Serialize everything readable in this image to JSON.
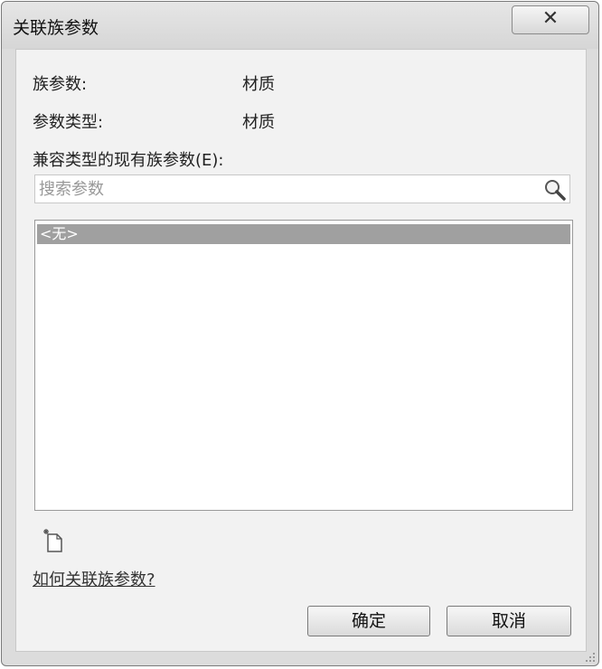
{
  "window": {
    "title": "关联族参数",
    "close_glyph": "✕"
  },
  "fields": {
    "family_param_label": "族参数:",
    "family_param_value": "材质",
    "param_type_label": "参数类型:",
    "param_type_value": "材质",
    "compatible_label": "兼容类型的现有族参数(E):"
  },
  "search": {
    "placeholder": "搜索参数",
    "value": ""
  },
  "list": {
    "items": [
      {
        "label": "<无>",
        "selected": true
      }
    ]
  },
  "help": {
    "link_text": "如何关联族参数?"
  },
  "buttons": {
    "ok_label": "确定",
    "cancel_label": "取消"
  },
  "icons": {
    "search": "search-icon",
    "new_parameter": "new-parameter-icon",
    "close": "close-icon",
    "resize_grip": "resize-grip-icon"
  }
}
